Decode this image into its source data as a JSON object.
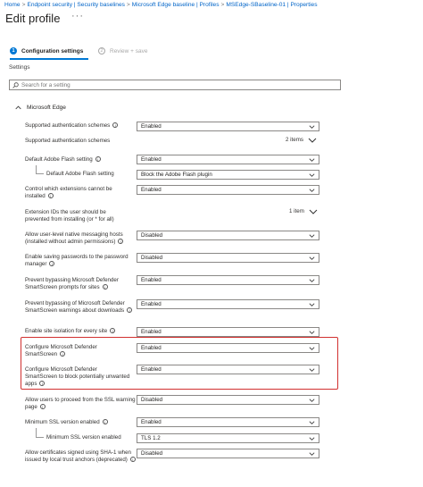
{
  "breadcrumb": {
    "items": [
      "Home",
      "Endpoint security | Security baselines",
      "Microsoft Edge baseline | Profiles",
      "MSEdge-SBaseline-01 | Properties"
    ],
    "separator": ">"
  },
  "header": {
    "title": "Edit profile",
    "more": "···"
  },
  "steps": [
    {
      "num": "1",
      "label": "Configuration settings"
    },
    {
      "num": "2",
      "label": "Review + save"
    }
  ],
  "settings_label": "Settings",
  "search": {
    "placeholder": "Search for a setting"
  },
  "section": {
    "title": "Microsoft Edge"
  },
  "rows": [
    {
      "label": "Supported authentication schemes",
      "info": true,
      "value": "Enabled"
    },
    {
      "label": "Supported authentication schemes",
      "items": "2 items"
    },
    {
      "label": "Default Adobe Flash setting",
      "info": true,
      "value": "Enabled"
    },
    {
      "label": "Default Adobe Flash setting",
      "value": "Block the Adobe Flash plugin"
    },
    {
      "label": "Control which extensions cannot be installed",
      "info": true,
      "value": "Enabled"
    },
    {
      "label": "Extension IDs the user should be prevented from installing (or * for all)",
      "items": "1 item"
    },
    {
      "label": "Allow user-level native messaging hosts (installed without admin permissions)",
      "info": true,
      "value": "Disabled"
    },
    {
      "label": "Enable saving passwords to the password manager",
      "info": true,
      "value": "Disabled"
    },
    {
      "label": "Prevent bypassing Microsoft Defender SmartScreen prompts for sites",
      "info": true,
      "value": "Enabled"
    },
    {
      "label": "Prevent bypassing of Microsoft Defender SmartScreen warnings about downloads",
      "info": true,
      "value": "Enabled"
    },
    {
      "label": "Enable site isolation for every site",
      "info": true,
      "value": "Enabled"
    },
    {
      "label": "Configure Microsoft Defender SmartScreen",
      "info": true,
      "value": "Enabled"
    },
    {
      "label": "Configure Microsoft Defender SmartScreen to block potentially unwanted apps",
      "info": true,
      "value": "Enabled"
    },
    {
      "label": "Allow users to proceed from the SSL warning page",
      "info": true,
      "value": "Disabled"
    },
    {
      "label": "Minimum SSL version enabled",
      "info": true,
      "value": "Enabled"
    },
    {
      "label": "Minimum SSL version enabled",
      "value": "TLS 1.2"
    },
    {
      "label": "Allow certificates signed using SHA-1 when issued by local trust anchors (deprecated)",
      "info": true,
      "value": "Disabled"
    }
  ],
  "colors": {
    "accent": "#0078d4",
    "link": "#0064c8",
    "highlight": "#d1302f"
  }
}
